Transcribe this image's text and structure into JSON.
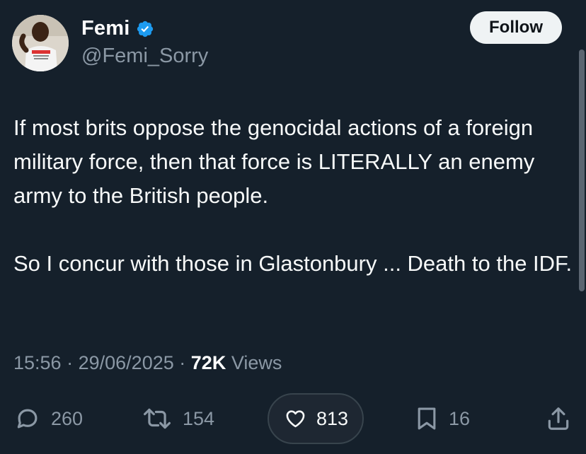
{
  "author": {
    "display_name": "Femi",
    "handle": "@Femi_Sorry",
    "verified": true
  },
  "follow_label": "Follow",
  "body": {
    "paragraph_1": "If most brits oppose the genocidal actions of a foreign military force, then that force is LITERALLY an enemy army to the British people.",
    "paragraph_2": "So I concur with those in Glastonbury ... Death to the IDF."
  },
  "meta": {
    "time": "15:56",
    "date": "29/06/2025",
    "views_count": "72K",
    "views_label": "Views",
    "separator": "·"
  },
  "actions": {
    "replies": "260",
    "reposts": "154",
    "likes": "813",
    "bookmarks": "16"
  },
  "colors": {
    "background": "#15202b",
    "secondary_text": "#8b98a5",
    "verified_badge": "#1d9bf0"
  },
  "icons": [
    "verified-icon",
    "reply-icon",
    "repost-icon",
    "like-icon",
    "bookmark-icon",
    "share-icon"
  ]
}
